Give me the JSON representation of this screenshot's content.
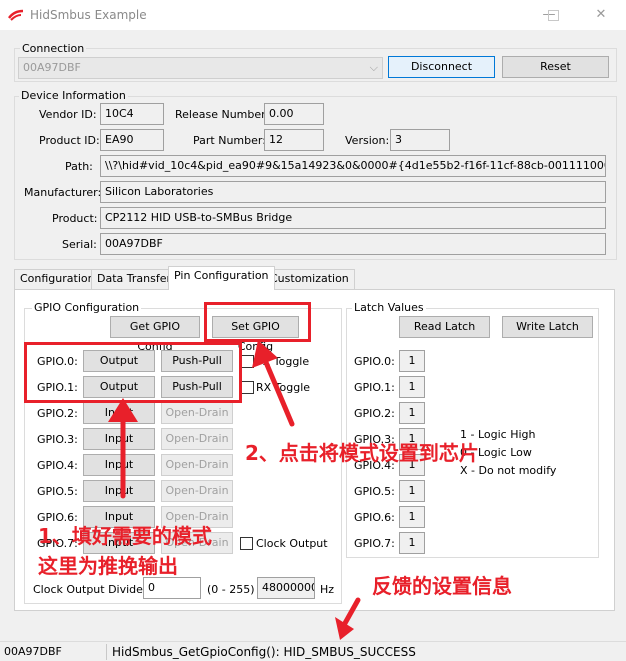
{
  "window": {
    "title": "HidSmbus Example"
  },
  "connection": {
    "group_label": "Connection",
    "device_value": "00A97DBF",
    "disconnect_label": "Disconnect",
    "reset_label": "Reset"
  },
  "device_info": {
    "group_label": "Device Information",
    "vendor_id_label": "Vendor ID:",
    "vendor_id": "10C4",
    "release_label": "Release Number:",
    "release": "0.00",
    "product_id_label": "Product ID:",
    "product_id": "EA90",
    "part_label": "Part Number:",
    "part": "12",
    "version_label": "Version:",
    "version": "3",
    "path_label": "Path:",
    "path": "\\\\?\\hid#vid_10c4&pid_ea90#9&15a14923&0&0000#{4d1e55b2-f16f-11cf-88cb-001111000030}",
    "manufacturer_label": "Manufacturer:",
    "manufacturer": "Silicon Laboratories",
    "product_label": "Product:",
    "product": "CP2112 HID USB-to-SMBus Bridge",
    "serial_label": "Serial:",
    "serial": "00A97DBF"
  },
  "tabs": [
    "Configuration",
    "Data Transfer",
    "Pin Configuration",
    "Customization"
  ],
  "gpio": {
    "group_label": "GPIO Configuration",
    "get_label": "Get GPIO Config",
    "set_label": "Set GPIO Config",
    "rows": [
      {
        "label": "GPIO.0:",
        "dir": "Output",
        "mode": "Push-Pull",
        "extra": "TX Toggle"
      },
      {
        "label": "GPIO.1:",
        "dir": "Output",
        "mode": "Push-Pull",
        "extra": "RX Toggle"
      },
      {
        "label": "GPIO.2:",
        "dir": "Input",
        "mode": "Open-Drain"
      },
      {
        "label": "GPIO.3:",
        "dir": "Input",
        "mode": "Open-Drain"
      },
      {
        "label": "GPIO.4:",
        "dir": "Input",
        "mode": "Open-Drain"
      },
      {
        "label": "GPIO.5:",
        "dir": "Input",
        "mode": "Open-Drain"
      },
      {
        "label": "GPIO.6:",
        "dir": "Input",
        "mode": "Open-Drain"
      },
      {
        "label": "GPIO.7:",
        "dir": "Input",
        "mode": "Open-Drain",
        "extra": "Clock Output"
      }
    ],
    "clock_divider_label": "Clock Output Divider:",
    "clock_divider_value": "0",
    "clock_range": "(0 - 255)",
    "clock_hz_value": "48000000",
    "hz_label": "Hz"
  },
  "latch": {
    "group_label": "Latch Values",
    "read_label": "Read Latch",
    "write_label": "Write Latch",
    "rows": [
      {
        "label": "GPIO.0:",
        "value": "1"
      },
      {
        "label": "GPIO.1:",
        "value": "1"
      },
      {
        "label": "GPIO.2:",
        "value": "1"
      },
      {
        "label": "GPIO.3:",
        "value": "1"
      },
      {
        "label": "GPIO.4:",
        "value": "1"
      },
      {
        "label": "GPIO.5:",
        "value": "1"
      },
      {
        "label": "GPIO.6:",
        "value": "1"
      },
      {
        "label": "GPIO.7:",
        "value": "1"
      }
    ],
    "legend": [
      "1 - Logic High",
      "0 - Logic Low",
      "X - Do not modify"
    ]
  },
  "annotations": {
    "step1_line1": "1、填好需要的模式",
    "step1_line2": "这里为推挽输出",
    "step2": "2、点击将模式设置到芯片",
    "feedback": "反馈的设置信息"
  },
  "status": {
    "device": "00A97DBF",
    "message": "HidSmbus_GetGpioConfig(): HID_SMBUS_SUCCESS"
  }
}
